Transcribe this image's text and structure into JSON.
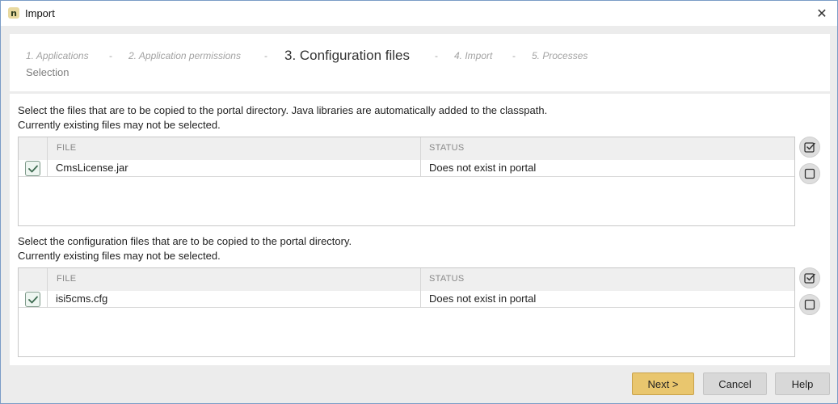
{
  "window": {
    "title": "Import",
    "app_icon_letter": "n",
    "close_glyph": "✕"
  },
  "wizard": {
    "steps": [
      {
        "label": "1. Applications"
      },
      {
        "label": "2. Application permissions"
      },
      {
        "label": "3. Configuration files",
        "current": true
      },
      {
        "label": "4. Import"
      },
      {
        "label": "5. Processes"
      }
    ],
    "separator": "-",
    "sub_label": "Selection"
  },
  "section1": {
    "description_line1": "Select the files that are to be copied to the portal directory. Java libraries are automatically added to the classpath.",
    "description_line2": "Currently existing files may not be selected.",
    "columns": {
      "file": "FILE",
      "status": "STATUS"
    },
    "rows": [
      {
        "checked": true,
        "file": "CmsLicense.jar",
        "status": "Does not exist in portal"
      }
    ]
  },
  "section2": {
    "description_line1": "Select the configuration files that are to be copied to the portal directory.",
    "description_line2": "Currently existing files may not be selected.",
    "columns": {
      "file": "FILE",
      "status": "STATUS"
    },
    "rows": [
      {
        "checked": true,
        "file": "isi5cms.cfg",
        "status": "Does not exist in portal"
      }
    ]
  },
  "footer": {
    "next_label": "Next >",
    "cancel_label": "Cancel",
    "help_label": "Help"
  },
  "colors": {
    "primary_button": "#e9c66e",
    "checkbox_check": "#3d6b50"
  },
  "icons": {
    "select_all": "select-all-icon",
    "deselect_all": "deselect-all-icon",
    "checkmark": "checkmark-icon",
    "close": "close-icon"
  }
}
